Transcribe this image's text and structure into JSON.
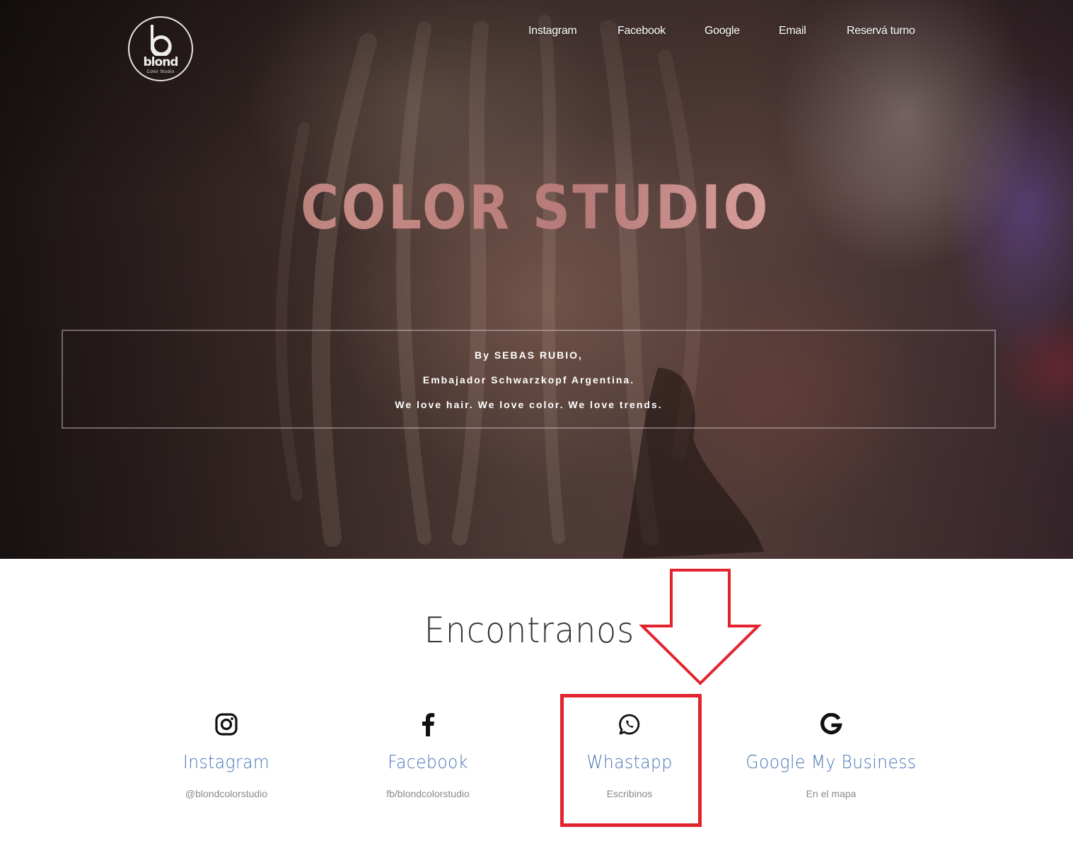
{
  "header": {
    "logo": {
      "word": "blond",
      "subtitle": "Color Studio"
    },
    "nav": [
      {
        "label": "Instagram"
      },
      {
        "label": "Facebook"
      },
      {
        "label": "Google"
      },
      {
        "label": "Email"
      },
      {
        "label": "Reservá turno"
      }
    ]
  },
  "hero": {
    "title": "COLOR STUDIO",
    "tagline": [
      "By SEBAS RUBIO,",
      "Embajador Schwarzkopf Argentina.",
      "We love hair. We love color. We love trends."
    ]
  },
  "find_us": {
    "title": "Encontranos",
    "items": [
      {
        "icon": "instagram-icon",
        "name": "Instagram",
        "sub": "@blondcolorstudio"
      },
      {
        "icon": "facebook-icon",
        "name": "Facebook",
        "sub": "fb/blondcolorstudio"
      },
      {
        "icon": "whatsapp-icon",
        "name": "Whastapp",
        "sub": "Escribinos"
      },
      {
        "icon": "google-icon",
        "name": "Google My Business",
        "sub": "En el mapa"
      }
    ]
  },
  "colors": {
    "link_blue": "#4a74b8",
    "annotation_red": "#e3232d",
    "hero_title_start": "#8f5a58",
    "hero_title_end": "#f0c6cc"
  }
}
